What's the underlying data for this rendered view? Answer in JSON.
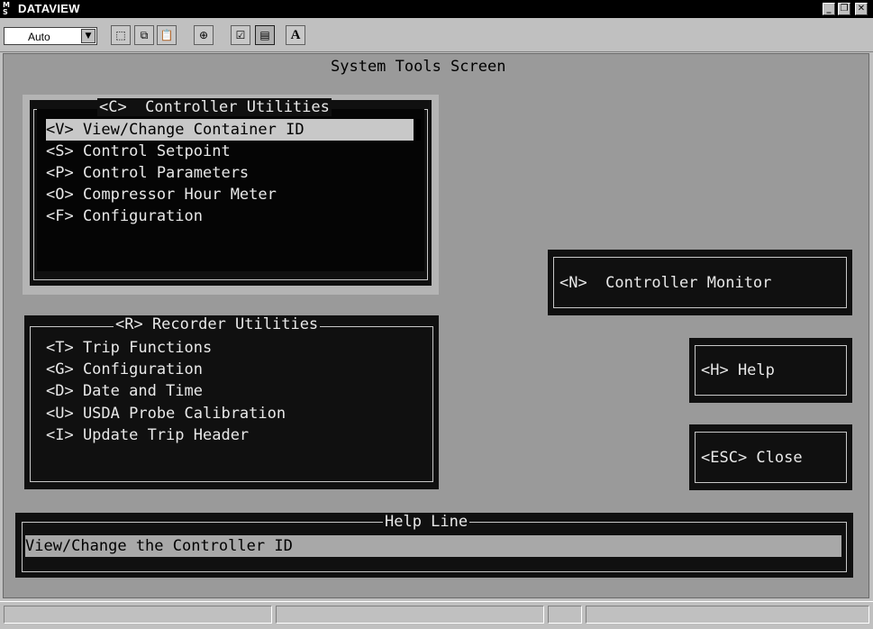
{
  "window": {
    "title": "DATAVIEW",
    "icon": "app-icon",
    "controls": [
      "minimize-icon",
      "maximize-icon",
      "close-icon"
    ]
  },
  "toolbar": {
    "zoom_value": "Auto",
    "font_button_label": "A"
  },
  "screen": {
    "title": "System Tools Screen"
  },
  "controller_utilities": {
    "title": "<C>  Controller Utilities",
    "items": [
      {
        "label": "<V> View/Change Container ID",
        "selected": true
      },
      {
        "label": "<S> Control Setpoint"
      },
      {
        "label": "<P> Control Parameters"
      },
      {
        "label": "<O> Compressor Hour Meter"
      },
      {
        "label": "<F> Configuration"
      }
    ]
  },
  "recorder_utilities": {
    "title": "<R> Recorder Utilities",
    "items": [
      {
        "label": "<T> Trip Functions"
      },
      {
        "label": "<G> Configuration"
      },
      {
        "label": "<D> Date and Time"
      },
      {
        "label": "<U> USDA Probe Calibration"
      },
      {
        "label": "<I> Update Trip Header"
      }
    ]
  },
  "buttons": {
    "controller_monitor": "<N>  Controller Monitor",
    "help": "<H> Help",
    "close": "<ESC> Close"
  },
  "help_line": {
    "title": "Help Line",
    "text": "View/Change the Controller ID"
  },
  "colors": {
    "screen_bg": "#9a9a9a",
    "panel_bg": "#101010",
    "panel_text": "#e8e8e8",
    "selection_bg": "#c8c8c8"
  }
}
